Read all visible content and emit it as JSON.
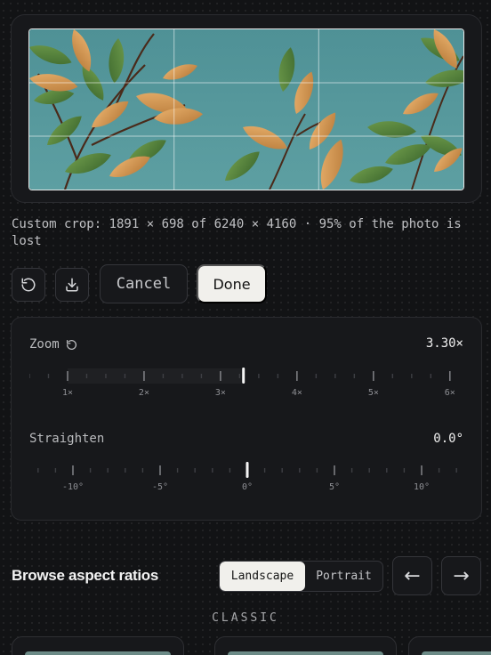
{
  "caption": "Custom crop: 1891 × 698 of 6240 × 4160 · 95% of the photo is lost",
  "actions": {
    "reset_icon": "rotate-ccw-icon",
    "download_icon": "download-icon",
    "cancel_label": "Cancel",
    "done_label": "Done"
  },
  "zoom": {
    "label": "Zoom",
    "value_text": "3.30×",
    "value": 3.3,
    "min": 0.5,
    "max": 6.2,
    "tick_labels": [
      "1×",
      "2×",
      "3×",
      "4×",
      "5×",
      "6×"
    ],
    "tick_values": [
      1,
      2,
      3,
      4,
      5,
      6
    ]
  },
  "straighten": {
    "label": "Straighten",
    "value_text": "0.0°",
    "value": 0,
    "min": -12.5,
    "max": 12.5,
    "tick_labels": [
      "-10°",
      "-5°",
      "0°",
      "5°",
      "10°"
    ],
    "tick_values": [
      -10,
      -5,
      0,
      5,
      10
    ]
  },
  "aspect": {
    "title": "Browse aspect ratios",
    "orientation_options": [
      "Landscape",
      "Portrait"
    ],
    "selected_orientation": "Landscape",
    "prev_symbol": "←",
    "next_symbol": "→",
    "group_label": "CLASSIC"
  },
  "colors": {
    "background": "#121315",
    "panel": "#17181b",
    "accent_button": "#f1f0ec",
    "sky": "#4d8f93"
  }
}
